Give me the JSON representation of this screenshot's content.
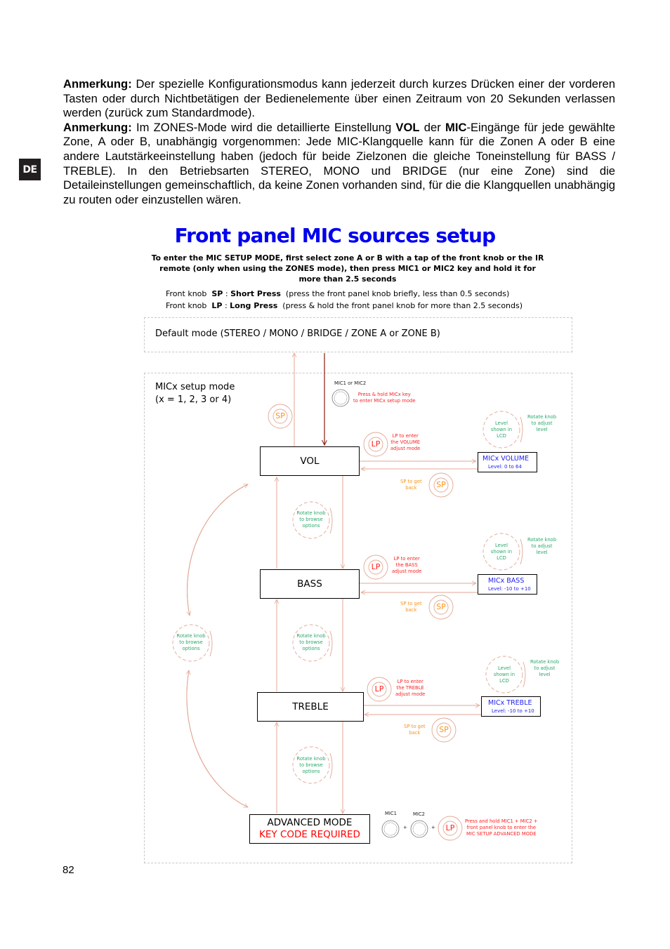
{
  "language_tab": "DE",
  "paragraphs": [
    {
      "lead": "Anmerkung:",
      "text": " Der spezielle Konfigurationsmodus kann jederzeit durch kurzes Drücken einer der vorderen Tasten oder durch Nichtbetätigen der Bedienelemente über einen Zeitraum von 20 Sekunden  verlassen werden (zurück zum Standardmode)."
    },
    {
      "lead": "Anmerkung:",
      "part1": " Im ZONES-Mode wird die detaillierte Einstellung ",
      "bold1": "VOL",
      "part2": " der ",
      "bold2": "MIC",
      "part3": "-Eingänge für jede gewählte Zone, A oder B, unabhängig vorgenommen: Jede MIC-Klangquelle kann für die Zonen A oder B eine andere Lautstärkeeinstellung haben (jedoch für beide Zielzonen die gleiche Toneinstellung für BASS / TREBLE). In den Betriebsarten STEREO, MONO und BRIDGE (nur eine Zone) sind die Detaileinstellungen gemeinschaftlich, da keine Zonen vorhanden sind, für die die Klangquellen unabhängig zu routen oder einzustellen wären."
    }
  ],
  "diagram": {
    "title": "Front panel MIC sources setup",
    "intro": "To enter the MIC SETUP MODE, first select zone A or B with a tap of the front knob or the IR remote (only when using the  ZONES mode), then press MIC1 or MIC2 key and hold it for more than 2.5 seconds",
    "legend": [
      {
        "prefix": "Front knob  ",
        "abbr": "SP",
        "sep": " : ",
        "term": "Short Press",
        "desc": "  (press the front panel knob briefly, less than 0.5 seconds)"
      },
      {
        "prefix": "Front knob  ",
        "abbr": "LP",
        "sep": " : ",
        "term": "Long Press",
        "desc": "  (press & hold the front panel knob for more than 2.5 seconds)"
      }
    ],
    "default_mode_label": "Default mode (STEREO / MONO / BRIDGE / ZONE A or ZONE B)",
    "setup_mode_label": [
      "MICx setup mode",
      "(x = 1, 2, 3 or 4)"
    ],
    "mic_key_label": "MIC1 or MIC2",
    "mic_key_note": [
      "Press & hold MICx key",
      "to enter MICx setup mode"
    ],
    "sp_badge": "SP",
    "lp_badge": "LP",
    "states": [
      {
        "name": "VOL",
        "lp_note": [
          "LP to enter",
          "the VOLUME",
          "adjust mode"
        ],
        "lcd_title": "MICx VOLUME",
        "lcd_level": "Level: 0 to 64",
        "sp_note": [
          "SP to get",
          "back"
        ],
        "level_note": [
          "Level",
          "shown in",
          "LCD"
        ],
        "rotate_note": [
          "Rotate knob",
          "to adjust",
          "level"
        ]
      },
      {
        "name": "BASS",
        "lp_note": [
          "LP to enter",
          "the BASS",
          "adjust mode"
        ],
        "lcd_title": "MICx BASS",
        "lcd_level": "Level: -10 to +10",
        "sp_note": [
          "SP to get",
          "back"
        ],
        "level_note": [
          "Level",
          "shown in",
          "LCD"
        ],
        "rotate_note": [
          "Rotate knob",
          "to adjust",
          "level"
        ]
      },
      {
        "name": "TREBLE",
        "lp_note": [
          "LP to enter",
          "the TREBLE",
          "adjust mode"
        ],
        "lcd_title": "MICx TREBLE",
        "lcd_level": "Level: -10 to +10",
        "sp_note": [
          "SP to get",
          "back"
        ],
        "level_note": [
          "Level",
          "shown in",
          "LCD"
        ],
        "rotate_note": [
          "Rotate knob",
          "to adjust",
          "level"
        ]
      }
    ],
    "browse_note": [
      "Rotate knob",
      "to browse",
      "options"
    ],
    "advanced": {
      "line1": "ADVANCED MODE",
      "line2": "KEY CODE REQUIRED",
      "mic1": "MIC1",
      "mic2": "MIC2",
      "plus": "+",
      "note": [
        "Press and hold MIC1 + MIC2 +",
        "front panel knob to enter the",
        "MIC SETUP ADVANCED MODE"
      ]
    },
    "colors": {
      "title_blue": "#0000ee",
      "lcd_blue": "#2222ee",
      "red": "#ff2020",
      "orange": "#f7941d",
      "green": "#29a86a",
      "arrow": "#e3a793",
      "arrow_dark": "#8b1a0a"
    }
  },
  "page_number": "82"
}
